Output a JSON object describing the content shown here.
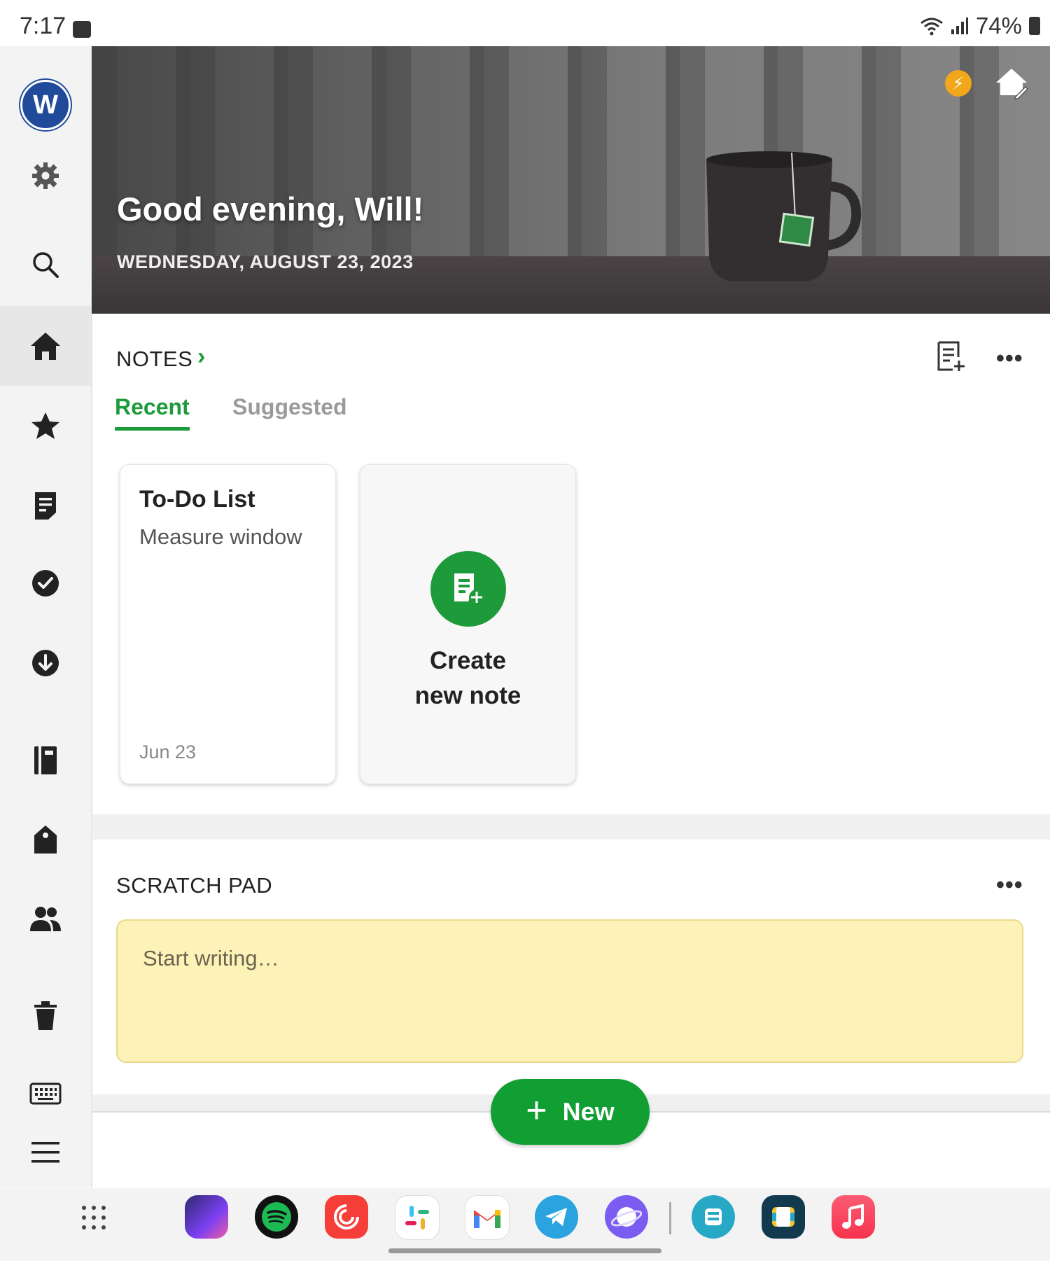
{
  "status_bar": {
    "time": "7:17",
    "battery": "74%",
    "icons": [
      "gallery-icon",
      "wifi-icon",
      "signal-icon",
      "battery-icon"
    ]
  },
  "sidebar": {
    "avatar_letter": "W",
    "items": [
      {
        "name": "settings",
        "icon": "gear-icon"
      },
      {
        "name": "search",
        "icon": "search-icon"
      },
      {
        "name": "home",
        "icon": "home-icon",
        "active": true
      },
      {
        "name": "shortcuts",
        "icon": "star-icon"
      },
      {
        "name": "notes",
        "icon": "note-icon"
      },
      {
        "name": "tasks",
        "icon": "check-circle-icon"
      },
      {
        "name": "offline",
        "icon": "download-icon"
      },
      {
        "name": "notebooks",
        "icon": "notebook-icon"
      },
      {
        "name": "tags",
        "icon": "tag-icon"
      },
      {
        "name": "shared",
        "icon": "people-icon"
      },
      {
        "name": "trash",
        "icon": "trash-icon"
      },
      {
        "name": "keyboard",
        "icon": "keyboard-icon"
      },
      {
        "name": "menu",
        "icon": "hamburger-icon"
      }
    ]
  },
  "hero": {
    "greeting": "Good evening, Will!",
    "date": "WEDNESDAY, AUGUST 23, 2023"
  },
  "notes": {
    "title": "NOTES",
    "more": "•••",
    "tabs": [
      {
        "label": "Recent",
        "active": true
      },
      {
        "label": "Suggested",
        "active": false
      }
    ],
    "cards": [
      {
        "title": "To-Do List",
        "snippet": "Measure window",
        "date": "Jun 23"
      }
    ],
    "create_label_line1": "Create",
    "create_label_line2": "new note"
  },
  "scratch_pad": {
    "title": "SCRATCH PAD",
    "more": "•••",
    "placeholder": "Start writing…"
  },
  "new_button": {
    "plus": "+",
    "label": "New"
  },
  "dock": {
    "apps": [
      {
        "name": "bezel",
        "color": "#6b3df0"
      },
      {
        "name": "spotify",
        "color": "#1db954"
      },
      {
        "name": "pocket-casts",
        "color": "#f43e37"
      },
      {
        "name": "slack",
        "color": "#ffffff"
      },
      {
        "name": "gmail",
        "color": "#ffffff"
      },
      {
        "name": "telegram",
        "color": "#2aa3df"
      },
      {
        "name": "samsung-internet",
        "color": "#7a5cf0"
      },
      {
        "name": "app-blue",
        "color": "#27a9c6"
      },
      {
        "name": "app-dark",
        "color": "#12394e"
      },
      {
        "name": "music",
        "color": "#f7334e"
      }
    ]
  },
  "colors": {
    "accent": "#1d9a3a",
    "scratch_bg": "#fdf3b8",
    "avatar": "#1f4b9a",
    "bolt": "#f2a61a"
  }
}
